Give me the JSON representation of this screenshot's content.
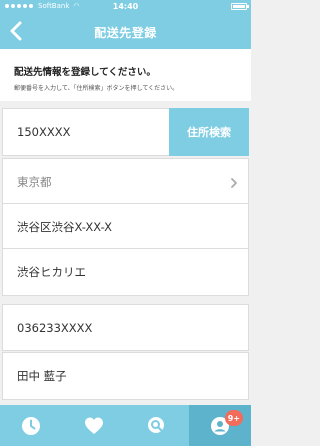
{
  "status_bar": {
    "carrier": "SoftBank",
    "time": "14:40"
  },
  "nav": {
    "title": "配送先登録",
    "back_icon": "chevron-left-icon"
  },
  "intro": {
    "heading": "配送先情報を登録してください。",
    "subtext": "郵便番号を入力して、「住所検索」ボタンを押してください。"
  },
  "form": {
    "zip": "150XXXX",
    "search_button": "住所検索",
    "prefecture": "東京都",
    "city": "渋谷区渋谷X-XX-X",
    "building": "渋谷ヒカリエ",
    "phone": "036233XXXX",
    "name": "田中 藍子"
  },
  "tab_bar": {
    "tabs": [
      {
        "icon": "clock-icon"
      },
      {
        "icon": "heart-icon"
      },
      {
        "icon": "search-icon"
      },
      {
        "icon": "profile-icon",
        "badge": "9+"
      }
    ]
  },
  "colors": {
    "accent": "#7ecde3",
    "accent_dark": "#5db3cc",
    "badge": "#f26b5b",
    "background": "#f0f0f0"
  }
}
